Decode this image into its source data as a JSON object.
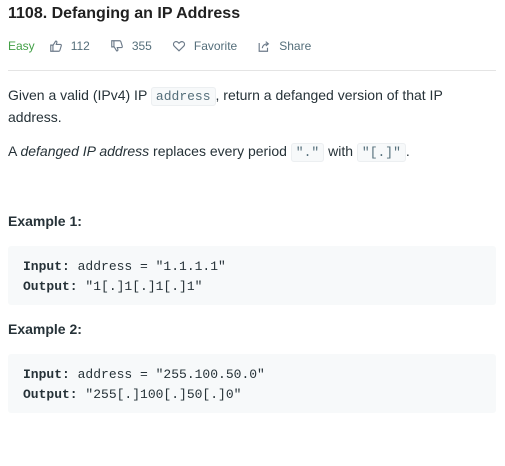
{
  "problem": {
    "title": "1108. Defanging an IP Address",
    "difficulty": "Easy",
    "likes": "112",
    "dislikes": "355",
    "favorite_label": "Favorite",
    "share_label": "Share"
  },
  "description": {
    "p1_before": "Given a valid (IPv4) IP ",
    "p1_code": "address",
    "p1_after": ", return a defanged version of that IP address.",
    "p2_start": "A ",
    "p2_em": "defanged IP address",
    "p2_mid": " replaces every period ",
    "p2_code1": "\".\"",
    "p2_with": " with ",
    "p2_code2": "\"[.]\"",
    "p2_end": "."
  },
  "examples": [
    {
      "title": "Example 1:",
      "input_label": "Input:",
      "input_value": " address = \"1.1.1.1\"",
      "output_label": "Output:",
      "output_value": " \"1[.]1[.]1[.]1\""
    },
    {
      "title": "Example 2:",
      "input_label": "Input:",
      "input_value": " address = \"255.100.50.0\"",
      "output_label": "Output:",
      "output_value": " \"255[.]100[.]50[.]0\""
    }
  ]
}
